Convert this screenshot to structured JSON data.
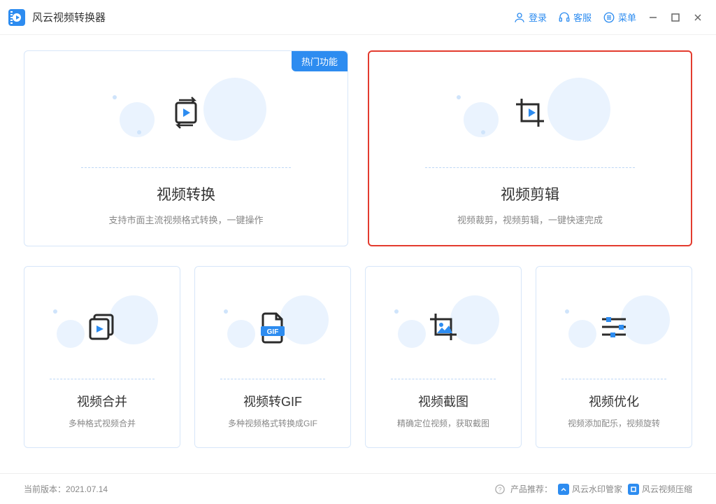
{
  "app": {
    "title": "风云视频转换器"
  },
  "titlebar": {
    "login": "登录",
    "support": "客服",
    "menu": "菜单"
  },
  "cards": {
    "convert": {
      "badge": "热门功能",
      "title": "视频转换",
      "desc": "支持市面主流视频格式转换，一键操作"
    },
    "edit": {
      "title": "视频剪辑",
      "desc": "视频裁剪，视频剪辑，一键快速完成"
    },
    "merge": {
      "title": "视频合并",
      "desc": "多种格式视频合并"
    },
    "gif": {
      "title": "视频转GIF",
      "desc": "多种视频格式转换成GIF"
    },
    "screenshot": {
      "title": "视频截图",
      "desc": "精确定位视频，获取截图"
    },
    "optimize": {
      "title": "视频优化",
      "desc": "视频添加配乐，视频旋转"
    }
  },
  "footer": {
    "version_label": "当前版本：",
    "version": "2021.07.14",
    "recommend_label": "产品推荐：",
    "rec1": "风云水印管家",
    "rec2": "风云视频压缩"
  }
}
